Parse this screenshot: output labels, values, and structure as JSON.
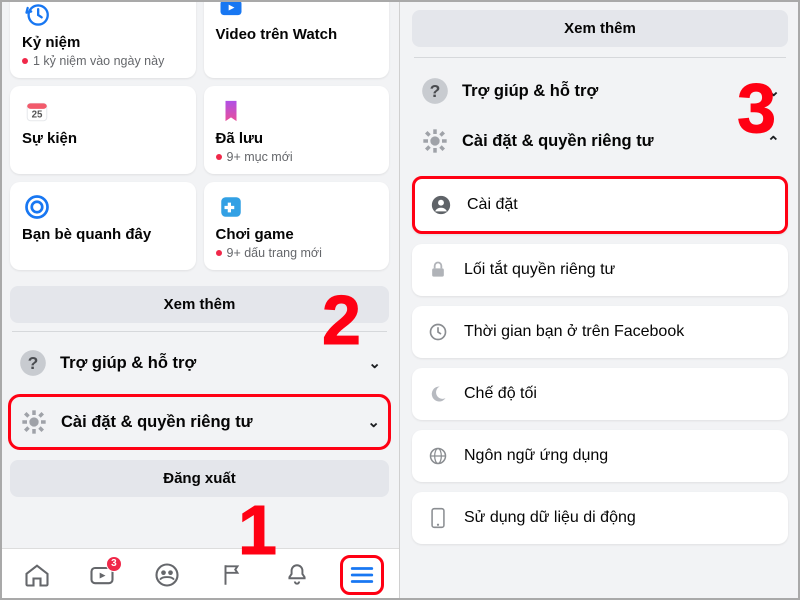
{
  "left": {
    "cards": [
      {
        "title": "Kỷ niệm",
        "sub": "1 kỷ niệm vào ngày này",
        "dot": true
      },
      {
        "title": "Video trên Watch",
        "sub": "",
        "dot": false
      },
      {
        "title": "Sự kiện",
        "sub": "",
        "dot": false
      },
      {
        "title": "Đã lưu",
        "sub": "9+ mục mới",
        "dot": true
      },
      {
        "title": "Bạn bè quanh đây",
        "sub": "",
        "dot": false
      },
      {
        "title": "Chơi game",
        "sub": "9+ dấu trang mới",
        "dot": true
      }
    ],
    "see_more": "Xem thêm",
    "help_label": "Trợ giúp & hỗ trợ",
    "settings_label": "Cài đặt & quyền riêng tư",
    "logout": "Đăng xuất",
    "tab_badge": "3"
  },
  "right": {
    "see_more": "Xem thêm",
    "help_label": "Trợ giúp & hỗ trợ",
    "settings_label": "Cài đặt & quyền riêng tư",
    "items": [
      "Cài đặt",
      "Lối tắt quyền riêng tư",
      "Thời gian bạn ở trên Facebook",
      "Chế độ tối",
      "Ngôn ngữ ứng dụng",
      "Sử dụng dữ liệu di động"
    ]
  },
  "steps": {
    "one": "1",
    "two": "2",
    "three": "3"
  }
}
